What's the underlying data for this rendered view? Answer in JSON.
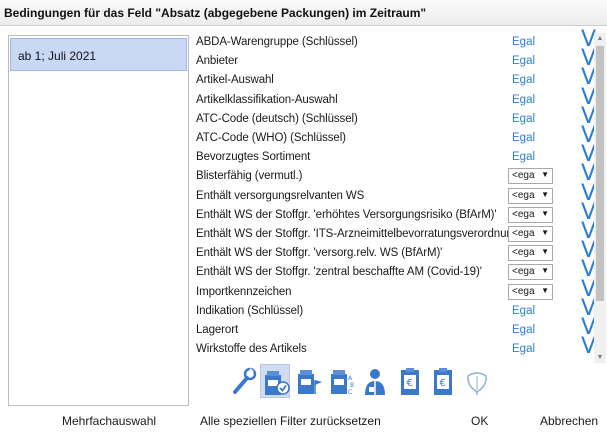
{
  "dialog": {
    "title": "Bedingungen für das Feld \"Absatz (abgegebene Packungen) im Zeitraum\""
  },
  "periods": [
    {
      "label": "ab 1; Juli 2021"
    }
  ],
  "attributes": [
    {
      "label": "ABDA-Warengruppe (Schlüssel)",
      "value": "Egal",
      "control": "link"
    },
    {
      "label": "Anbieter",
      "value": "Egal",
      "control": "link"
    },
    {
      "label": "Artikel-Auswahl",
      "value": "Egal",
      "control": "link"
    },
    {
      "label": "Artikelklassifikation-Auswahl",
      "value": "Egal",
      "control": "link"
    },
    {
      "label": "ATC-Code (deutsch) (Schlüssel)",
      "value": "Egal",
      "control": "link"
    },
    {
      "label": "ATC-Code (WHO) (Schlüssel)",
      "value": "Egal",
      "control": "link"
    },
    {
      "label": "Bevorzugtes Sortiment",
      "value": "Egal",
      "control": "link"
    },
    {
      "label": "Blisterfähig (vermutl.)",
      "value": "<ega",
      "control": "select"
    },
    {
      "label": "Enthält versorgungsrelvanten WS",
      "value": "<ega",
      "control": "select"
    },
    {
      "label": "Enthält WS der Stoffgr. 'erhöhtes Versorgungsrisiko (BfArM)'",
      "value": "<ega",
      "control": "select"
    },
    {
      "label": "Enthält WS der Stoffgr. 'ITS-Arzneimittelbevorratungsverordnung'",
      "value": "<ega",
      "control": "select"
    },
    {
      "label": "Enthält WS der Stoffgr. 'versorg.relv. WS (BfArM)'",
      "value": "<ega",
      "control": "select"
    },
    {
      "label": "Enthält WS der Stoffgr. 'zentral beschaffte AM (Covid-19)'",
      "value": "<ega",
      "control": "select"
    },
    {
      "label": "Importkennzeichen",
      "value": "<ega",
      "control": "select"
    },
    {
      "label": "Indikation (Schlüssel)",
      "value": "Egal",
      "control": "link"
    },
    {
      "label": "Lagerort",
      "value": "Egal",
      "control": "link"
    },
    {
      "label": "Wirkstoffe des Artikels",
      "value": "Egal",
      "control": "link"
    }
  ],
  "v_glyph": "V",
  "scrollbar": {
    "up": "▲",
    "down": "▼"
  },
  "toolbar_icons": [
    "wrench-icon",
    "pill-box-checked-icon",
    "pill-box-flag-icon",
    "pill-box-abc-icon",
    "pharmacist-icon",
    "clipboard-euro-icon",
    "clipboard-euro-2-icon",
    "ginkgo-leaf-icon"
  ],
  "footer": {
    "multi_select": "Mehrfachauswahl",
    "reset_filters": "Alle speziellen Filter zurücksetzen",
    "ok": "OK",
    "cancel": "Abbrechen"
  },
  "colors": {
    "accent": "#2a7fd4",
    "selection": "#c8d8f5",
    "icon_blue": "#3a78c9"
  }
}
